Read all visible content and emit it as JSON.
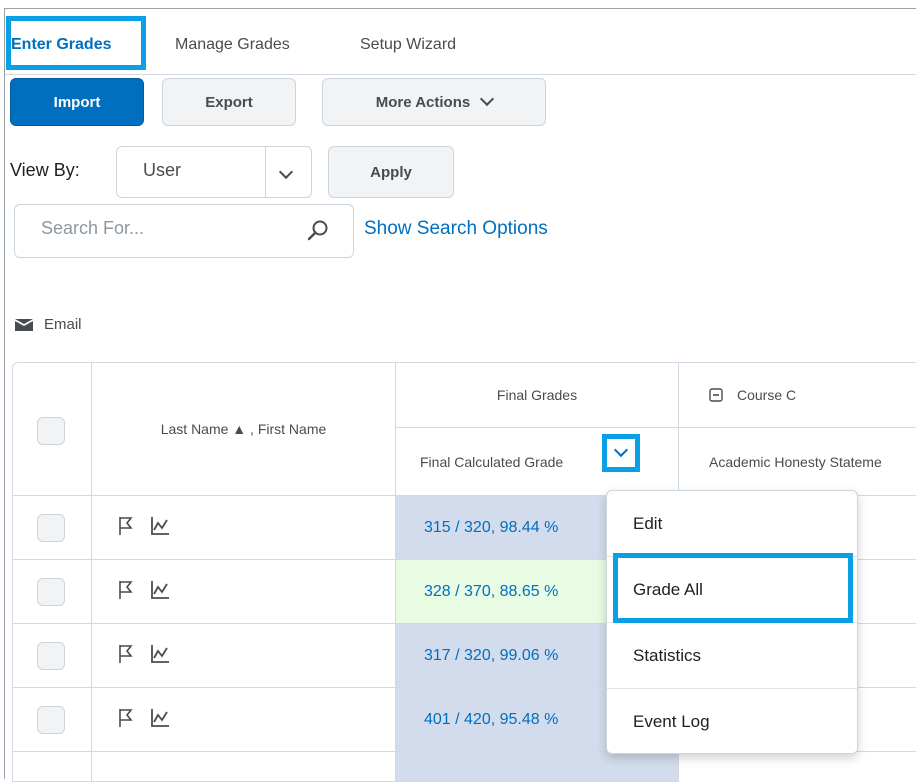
{
  "tabs": [
    {
      "label": "Enter Grades",
      "active": true
    },
    {
      "label": "Manage Grades",
      "active": false
    },
    {
      "label": "Setup Wizard",
      "active": false
    }
  ],
  "toolbar": {
    "import_label": "Import",
    "export_label": "Export",
    "more_actions_label": "More Actions"
  },
  "view_by": {
    "label": "View By:",
    "selected": "User",
    "apply_label": "Apply"
  },
  "search": {
    "placeholder": "Search For...",
    "show_options_label": "Show Search Options"
  },
  "email_label": "Email",
  "grid": {
    "name_header": "Last Name ▲ , First Name",
    "final_grades_header": "Final Grades",
    "final_calculated_header": "Final Calculated Grade",
    "course_header": "Course C",
    "academic_header": "Academic Honesty Stateme",
    "rows": [
      {
        "grade": "315 / 320, 98.44 %",
        "highlight": false
      },
      {
        "grade": "328 / 370, 88.65 %",
        "highlight": true
      },
      {
        "grade": "317 / 320, 99.06 %",
        "highlight": false
      },
      {
        "grade": "401 / 420, 95.48 %",
        "highlight": false
      }
    ]
  },
  "menu": {
    "items": [
      "Edit",
      "Grade All",
      "Statistics",
      "Event Log"
    ]
  },
  "colors": {
    "accent": "#006fbf",
    "highlight_border": "#0aa0e6",
    "grade_cell_bg": "#d2dcec",
    "grade_cell_highlight_bg": "#e8fbe3"
  }
}
